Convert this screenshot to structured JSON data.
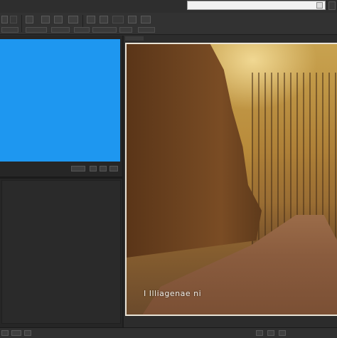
{
  "colors": {
    "preview_fill": "#1e97f0",
    "app_background": "#2b2b2b",
    "photo_border": "#e9e3d6"
  },
  "search": {
    "value": "",
    "placeholder": ""
  },
  "toolbar_icons": [
    "tool-icon",
    "tool-icon",
    "tool-icon",
    "tool-icon",
    "tool-icon",
    "tool-icon",
    "tool-icon"
  ],
  "photo": {
    "caption": "I Illiagenae ni"
  }
}
